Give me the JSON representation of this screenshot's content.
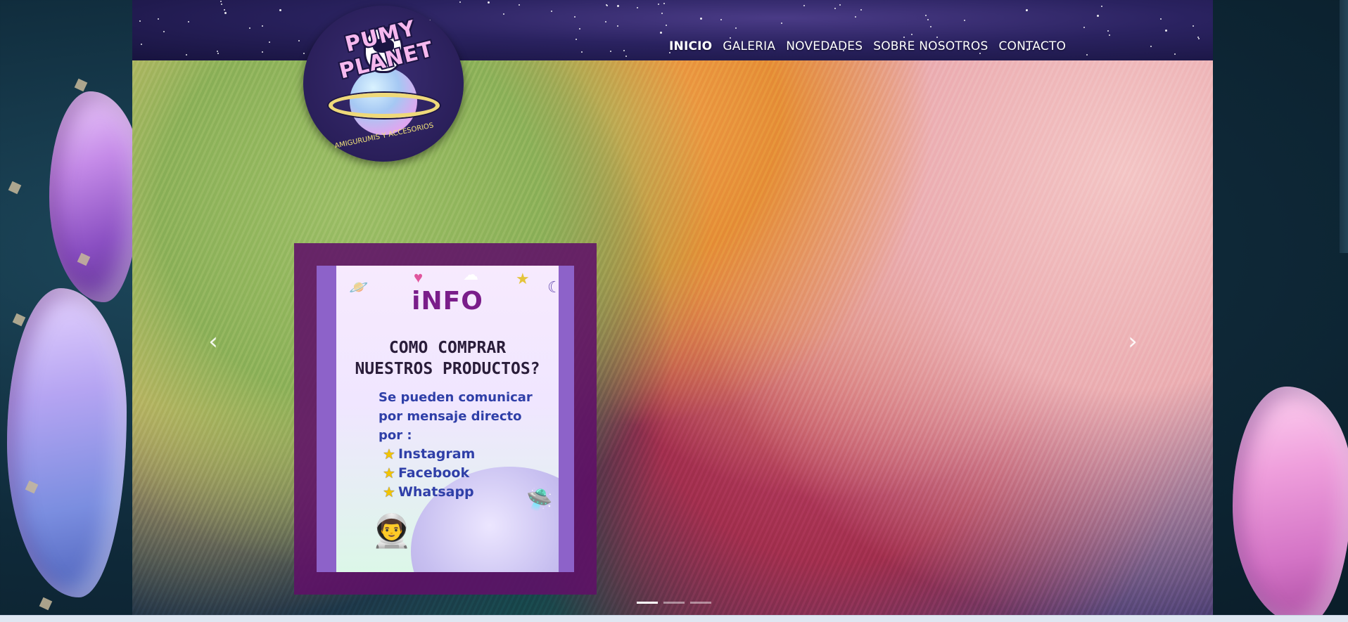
{
  "logo": {
    "title": "PUMY PLANET",
    "subtitle": "AMIGURUMIS Y ACCESORIOS"
  },
  "nav": {
    "items": [
      "INICIO",
      "GALERIA",
      "NOVEDADES",
      "SOBRE NOSOTROS",
      "CONTACTO"
    ],
    "active": "INICIO"
  },
  "slide": {
    "title": "iNFO",
    "heading_line1": "COMO COMPRAR",
    "heading_line2": "NUESTROS PRODUCTOS?",
    "body_line1": "Se pueden comunicar",
    "body_line2": "por mensaje directo",
    "body_line3": "por :",
    "channels": [
      "Instagram",
      "Facebook",
      "Whatsapp"
    ]
  },
  "slider": {
    "prev_glyph": "‹",
    "next_glyph": "›",
    "dots": 3,
    "active_dot": 1
  },
  "icons": {
    "star": "★",
    "ufo": "🛸",
    "astronaut": "👨‍🚀",
    "planet": "🪐",
    "heart": "♥",
    "cloud": "☁",
    "moon": "☾"
  },
  "colors": {
    "frame": "#601068",
    "accent_blue": "#2f3fa8",
    "title_purple": "#7a1d8a"
  }
}
